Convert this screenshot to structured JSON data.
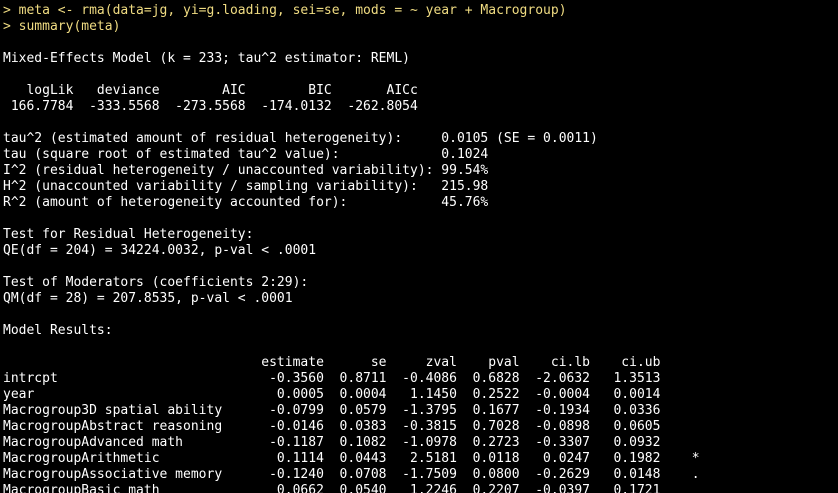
{
  "console": {
    "lines": [
      {
        "type": "cmd",
        "text": "> meta <- rma(data=jg, yi=g.loading, sei=se, mods = ~ year + Macrogroup)"
      },
      {
        "type": "cmd",
        "text": "> summary(meta)"
      },
      {
        "type": "out",
        "text": ""
      },
      {
        "type": "out",
        "text": "Mixed-Effects Model (k = 233; tau^2 estimator: REML)"
      },
      {
        "type": "out",
        "text": ""
      },
      {
        "type": "out",
        "text": "   logLik   deviance        AIC        BIC       AICc"
      },
      {
        "type": "out",
        "text": " 166.7784  -333.5568  -273.5568  -174.0132  -262.8054"
      },
      {
        "type": "out",
        "text": ""
      },
      {
        "type": "out",
        "text": "tau^2 (estimated amount of residual heterogeneity):     0.0105 (SE = 0.0011)"
      },
      {
        "type": "out",
        "text": "tau (square root of estimated tau^2 value):             0.1024"
      },
      {
        "type": "out",
        "text": "I^2 (residual heterogeneity / unaccounted variability): 99.54%"
      },
      {
        "type": "out",
        "text": "H^2 (unaccounted variability / sampling variability):   215.98"
      },
      {
        "type": "out",
        "text": "R^2 (amount of heterogeneity accounted for):            45.76%"
      },
      {
        "type": "out",
        "text": ""
      },
      {
        "type": "out",
        "text": "Test for Residual Heterogeneity:"
      },
      {
        "type": "out",
        "text": "QE(df = 204) = 34224.0032, p-val < .0001"
      },
      {
        "type": "out",
        "text": ""
      },
      {
        "type": "out",
        "text": "Test of Moderators (coefficients 2:29):"
      },
      {
        "type": "out",
        "text": "QM(df = 28) = 207.8535, p-val < .0001"
      },
      {
        "type": "out",
        "text": ""
      },
      {
        "type": "out",
        "text": "Model Results:"
      },
      {
        "type": "out",
        "text": ""
      },
      {
        "type": "out",
        "text": "                                 estimate      se     zval    pval    ci.lb    ci.ub"
      },
      {
        "type": "out",
        "text": "intrcpt                           -0.3560  0.8711  -0.4086  0.6828  -2.0632   1.3513"
      },
      {
        "type": "out",
        "text": "year                               0.0005  0.0004   1.1450  0.2522  -0.0004   0.0014"
      },
      {
        "type": "out",
        "text": "Macrogroup3D spatial ability      -0.0799  0.0579  -1.3795  0.1677  -0.1934   0.0336"
      },
      {
        "type": "out",
        "text": "MacrogroupAbstract reasoning      -0.0146  0.0383  -0.3815  0.7028  -0.0898   0.0605"
      },
      {
        "type": "out",
        "text": "MacrogroupAdvanced math           -0.1187  0.1082  -1.0978  0.2723  -0.3307   0.0932"
      },
      {
        "type": "out",
        "text": "MacrogroupArithmetic               0.1114  0.0443   2.5181  0.0118   0.0247   0.1982    *"
      },
      {
        "type": "out",
        "text": "MacrogroupAssociative memory      -0.1240  0.0708  -1.7509  0.0800  -0.2629   0.0148    ."
      },
      {
        "type": "out",
        "text": "MacrogroupBasic math               0.0662  0.0540   1.2246  0.2207  -0.0397   0.1721"
      }
    ]
  }
}
